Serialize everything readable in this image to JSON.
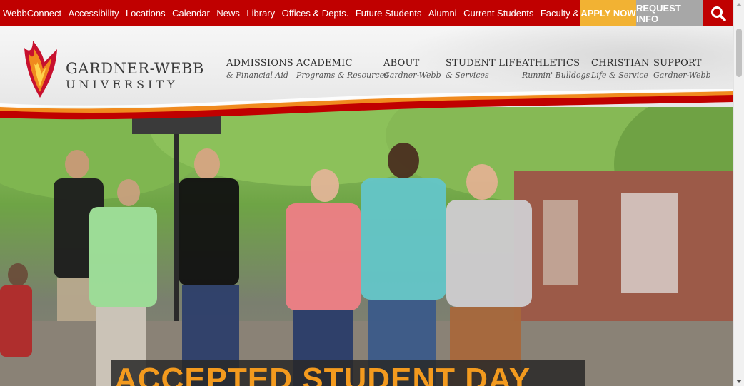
{
  "topbar": {
    "links": [
      "WebbConnect",
      "Accessibility",
      "Locations",
      "Calendar",
      "News",
      "Library",
      "Offices & Depts.",
      "Future Students",
      "Alumni",
      "Current Students",
      "Faculty & Staff"
    ],
    "apply_label": "APPLY NOW",
    "request_label": "REQUEST INFO",
    "search_icon": "search-icon"
  },
  "brand": {
    "name_line1": "GARDNER-WEBB",
    "name_line2": "UNIVERSITY",
    "logo_icon": "flame-shield-logo"
  },
  "nav": [
    {
      "label": "ADMISSIONS",
      "sub": "& Financial Aid"
    },
    {
      "label": "ACADEMIC",
      "sub": "Programs & Resources"
    },
    {
      "label": "ABOUT",
      "sub": "Gardner-Webb"
    },
    {
      "label": "STUDENT LIFE",
      "sub": "& Services"
    },
    {
      "label": "ATHLETICS",
      "sub": "Runnin' Bulldogs"
    },
    {
      "label": "CHRISTIAN",
      "sub": "Life & Service"
    },
    {
      "label": "SUPPORT",
      "sub": "Gardner-Webb"
    }
  ],
  "hero": {
    "title": "ACCEPTED STUDENT DAY"
  },
  "colors": {
    "brand_red": "#c00000",
    "apply_gold": "#f2b233",
    "request_gray": "#a7a7a7",
    "hero_title_orange": "#f39a1e"
  }
}
